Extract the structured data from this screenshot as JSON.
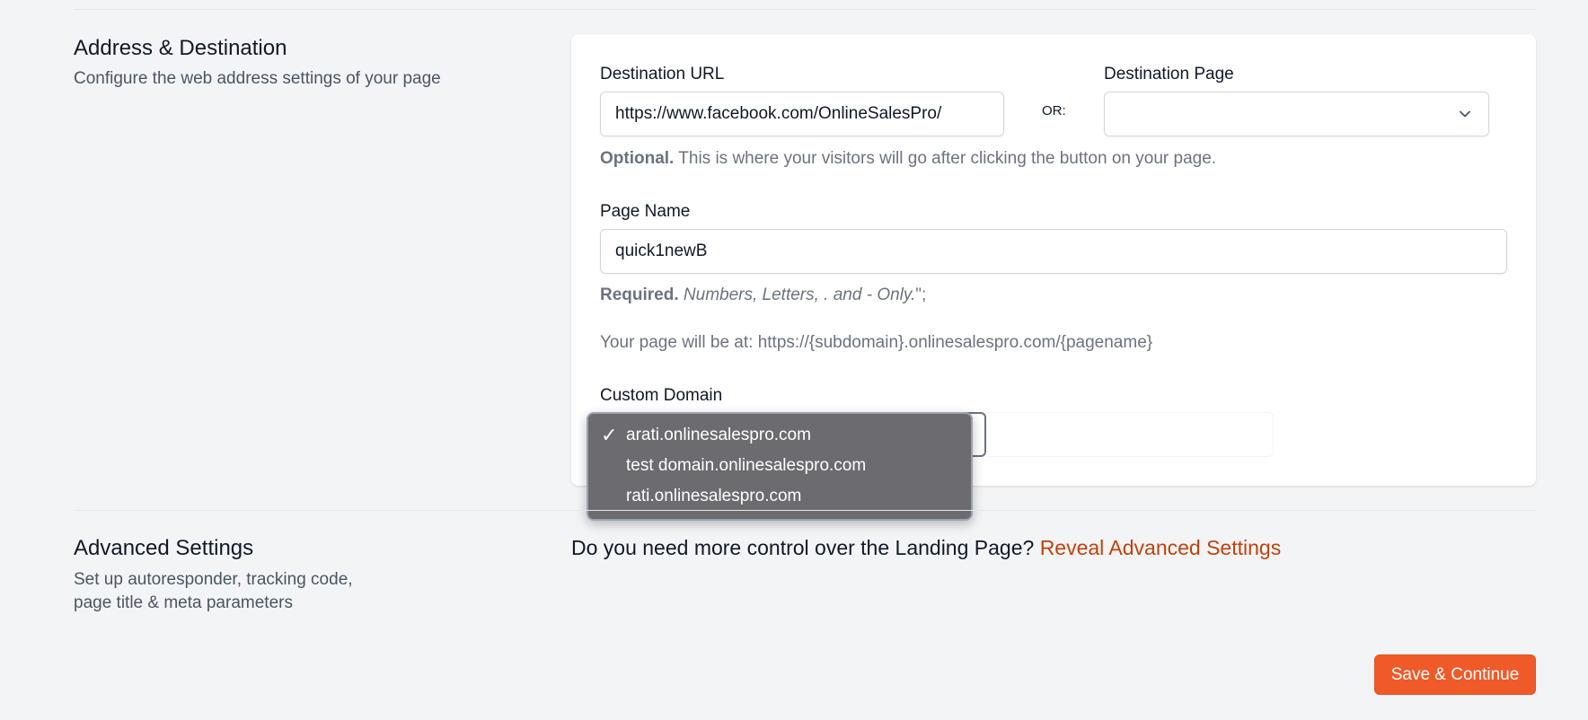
{
  "address_section": {
    "title": "Address & Destination",
    "description": "Configure the web address settings of your page"
  },
  "destination_url": {
    "label": "Destination URL",
    "value": "https://www.facebook.com/OnlineSalesPro/"
  },
  "or_label": "OR:",
  "destination_page": {
    "label": "Destination Page",
    "selected": ""
  },
  "destination_help": {
    "strong": "Optional.",
    "text": "This is where your visitors will go after clicking the button on your page."
  },
  "page_name": {
    "label": "Page Name",
    "value": "quick1newB"
  },
  "page_name_help": {
    "strong": "Required.",
    "italic": "Numbers, Letters, . and - Only.",
    "suffix": "\";"
  },
  "page_url_hint": "Your page will be at: https://{subdomain}.onlinesalespro.com/{pagename}",
  "custom_domain": {
    "label": "Custom Domain",
    "options": [
      {
        "label": "arati.onlinesalespro.com",
        "selected": true
      },
      {
        "label": "test domain.onlinesalespro.com",
        "selected": false
      },
      {
        "label": "rati.onlinesalespro.com",
        "selected": false
      }
    ],
    "check_glyph": "✓"
  },
  "advanced_section": {
    "title": "Advanced Settings",
    "description_line1": "Set up autoresponder, tracking code,",
    "description_line2": "page title & meta parameters",
    "question": "Do you need more control over the Landing Page?",
    "link": "Reveal Advanced Settings"
  },
  "save_button": "Save & Continue",
  "colors": {
    "accent": "#f05a28",
    "link": "#c2410c",
    "dropdown_bg": "#6b6b70"
  },
  "icons": {
    "select_chevron": "chevron-down-icon",
    "selected_option": "check-icon"
  }
}
